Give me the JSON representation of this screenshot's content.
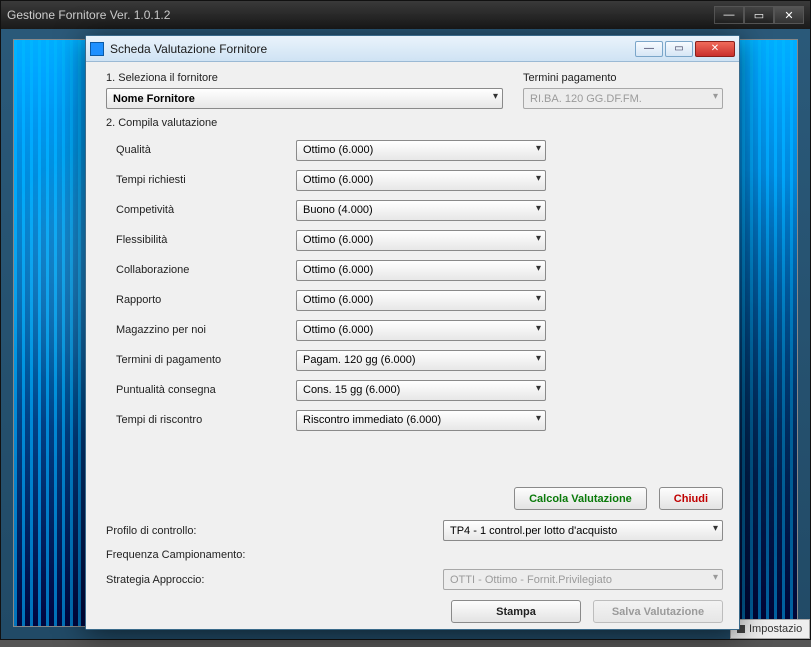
{
  "outer": {
    "title": "Gestione Fornitore Ver. 1.0.1.2",
    "footer_label": "Impostazio"
  },
  "dialog": {
    "title": "Scheda Valutazione Fornitore"
  },
  "step1": {
    "label": "1. Seleziona il fornitore",
    "supplier": "Nome Fornitore",
    "terms_label": "Termini pagamento",
    "terms_value": "RI.BA. 120 GG.DF.FM."
  },
  "step2_label": "2. Compila valutazione",
  "criteria": [
    {
      "label": "Qualità",
      "value": "Ottimo (6.000)"
    },
    {
      "label": "Tempi richiesti",
      "value": "Ottimo (6.000)"
    },
    {
      "label": "Competività",
      "value": "Buono (4.000)"
    },
    {
      "label": "Flessibilità",
      "value": "Ottimo (6.000)"
    },
    {
      "label": "Collaborazione",
      "value": "Ottimo (6.000)"
    },
    {
      "label": "Rapporto",
      "value": "Ottimo (6.000)"
    },
    {
      "label": "Magazzino per noi",
      "value": "Ottimo (6.000)"
    },
    {
      "label": "Termini di pagamento",
      "value": "Pagam. 120 gg (6.000)"
    },
    {
      "label": "Puntualità consegna",
      "value": "Cons. 15 gg (6.000)"
    },
    {
      "label": "Tempi di riscontro",
      "value": "Riscontro immediato (6.000)"
    }
  ],
  "actions": {
    "calc": "Calcola Valutazione",
    "close": "Chiudi",
    "print": "Stampa",
    "save": "Salva Valutazione"
  },
  "profile": {
    "control_label": "Profilo di controllo:",
    "control_value": "TP4 - 1 control.per lotto d'acquisto",
    "freq_label": "Frequenza Campionamento:",
    "freq_value": "",
    "strategy_label": "Strategia Approccio:",
    "strategy_value": "OTTI - Ottimo   - Fornit.Privilegiato"
  }
}
